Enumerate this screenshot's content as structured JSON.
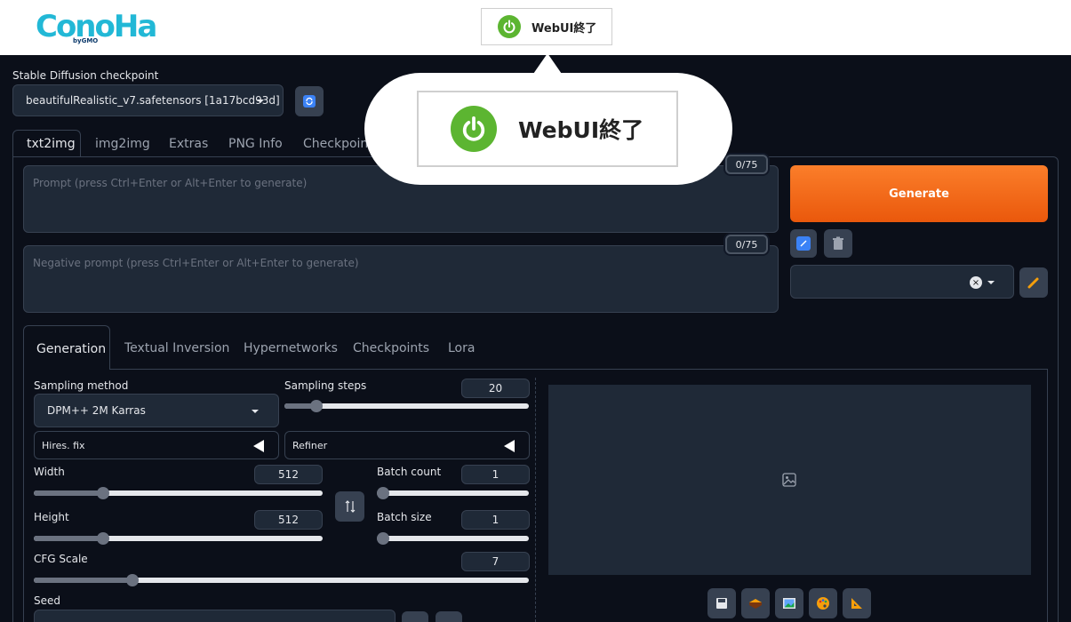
{
  "header": {
    "logo_text": "ConoHa",
    "logo_by": "by",
    "logo_gmo": "GMO",
    "stop_button_label": "WebUI終了"
  },
  "callout": {
    "stop_button_label": "WebUI終了"
  },
  "checkpoint": {
    "label": "Stable Diffusion checkpoint",
    "selected": "beautifulRealistic_v7.safetensors [1a17bcd93d]"
  },
  "main_tabs": [
    {
      "label": "txt2img",
      "active": true
    },
    {
      "label": "img2img"
    },
    {
      "label": "Extras"
    },
    {
      "label": "PNG Info"
    },
    {
      "label": "Checkpoint"
    }
  ],
  "prompt": {
    "placeholder": "Prompt (press Ctrl+Enter or Alt+Enter to generate)",
    "counter": "0/75"
  },
  "negative_prompt": {
    "placeholder": "Negative prompt (press Ctrl+Enter or Alt+Enter to generate)",
    "counter": "0/75"
  },
  "generate_label": "Generate",
  "sub_tabs": [
    {
      "label": "Generation",
      "active": true
    },
    {
      "label": "Textual Inversion"
    },
    {
      "label": "Hypernetworks"
    },
    {
      "label": "Checkpoints"
    },
    {
      "label": "Lora"
    }
  ],
  "sampling_method": {
    "label": "Sampling method",
    "value": "DPM++ 2M Karras"
  },
  "sampling_steps": {
    "label": "Sampling steps",
    "value": "20",
    "fraction": 0.13
  },
  "hires_fix": {
    "label": "Hires. fix"
  },
  "refiner": {
    "label": "Refiner"
  },
  "width": {
    "label": "Width",
    "value": "512",
    "fraction": 0.24
  },
  "height": {
    "label": "Height",
    "value": "512",
    "fraction": 0.24
  },
  "batch_count": {
    "label": "Batch count",
    "value": "1",
    "fraction": 0.0
  },
  "batch_size": {
    "label": "Batch size",
    "value": "1",
    "fraction": 0.0
  },
  "cfg_scale": {
    "label": "CFG Scale",
    "value": "7",
    "fraction": 0.2
  },
  "seed": {
    "label": "Seed"
  },
  "colors": {
    "accent": "#ea580c",
    "power": "#5cb531",
    "bg": "#0b0f19",
    "panel": "#1f2937"
  }
}
